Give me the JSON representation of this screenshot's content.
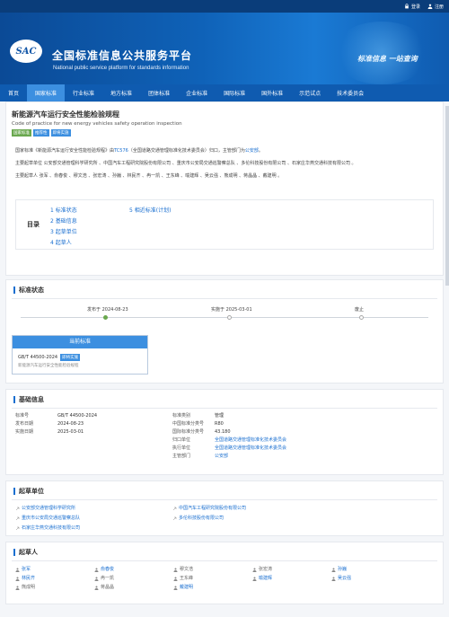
{
  "topbar": {
    "login": "登录",
    "register": "注册"
  },
  "banner": {
    "logo": "SAC",
    "title": "全国标准信息公共服务平台",
    "subtitle": "National public service platform  for standards information",
    "slogan": "标准信息 一站查询"
  },
  "nav": [
    "首页",
    "国家标准",
    "行业标准",
    "地方标准",
    "团体标准",
    "企业标准",
    "国际标准",
    "国外标准",
    "示范试点",
    "技术委员会"
  ],
  "std": {
    "title": "新能源汽车运行安全性能检验规程",
    "title_en": "Code of practice for new energy vehicles safety operation inspection",
    "badges": [
      "国家标准",
      "推荐性",
      "即将实施"
    ],
    "p1_a": "国家标准《新能源汽车运行安全性能检验规程》由",
    "p1_link1": "TC576",
    "p1_b": "（全国道路交通管理标准化技术委员会）归口，主管部门为",
    "p1_link2": "公安部",
    "p1_c": "。",
    "p2": "主要起草单位 公安部交通管理科学研究所 、中国汽车工程研究院股份有限公司 、重庆市公安局交通巡警察总队 、多伦科技股份有限公司 、石家庄华燕交通科技有限公司 。",
    "p3": "主要起草人 张军 、俞春俊 、穆文浩 、张宏涛 、孙巍 、林民齐 、冉一凯 、王东峰 、喻建辉 、吴云强 、熊成明 、蒋晶晶 、戴建明 。"
  },
  "toc": {
    "label": "目录",
    "col1": [
      "1  标准状态",
      "2  基础信息",
      "3  起草单位",
      "4  起草人"
    ],
    "col2": [
      "5  相近标准(计划)"
    ]
  },
  "status": {
    "heading": "标准状态",
    "publish": "发布于 2024-08-23",
    "implement": "实施于 2025-03-01",
    "abolish": "废止"
  },
  "current": {
    "header": "当前标准",
    "code": "GB/T 44500-2024",
    "tag": "即将实施",
    "desc": "新能源汽车运行安全性能检验规程"
  },
  "basic": {
    "heading": "基础信息",
    "left": [
      {
        "k": "标准号",
        "v": "GB/T 44500-2024"
      },
      {
        "k": "发布日期",
        "v": "2024-08-23"
      },
      {
        "k": "实施日期",
        "v": "2025-03-01"
      }
    ],
    "right": [
      {
        "k": "标准类别",
        "v": "管理"
      },
      {
        "k": "中国标准分类号",
        "v": "R80"
      },
      {
        "k": "国际标准分类号",
        "v": "43.180"
      },
      {
        "k": "归口单位",
        "v": "全国道路交通管理标准化技术委员会"
      },
      {
        "k": "执行单位",
        "v": "全国道路交通管理标准化技术委员会"
      },
      {
        "k": "主管部门",
        "v": "公安部"
      }
    ]
  },
  "drafters_units": {
    "heading": "起草单位",
    "items": [
      "公安部交通管理科学研究所",
      "中国汽车工程研究院股份有限公司",
      "重庆市公安局交通巡警察总队",
      "多伦科技股份有限公司",
      "石家庄华燕交通科技有限公司"
    ]
  },
  "drafters": {
    "heading": "起草人",
    "items": [
      "张军",
      "俞春俊",
      "穆文浩",
      "张宏涛",
      "孙巍",
      "林民齐",
      "冉一凯",
      "王东峰",
      "喻建辉",
      "吴云强",
      "熊成明",
      "蒋晶晶",
      "戴建明"
    ]
  }
}
